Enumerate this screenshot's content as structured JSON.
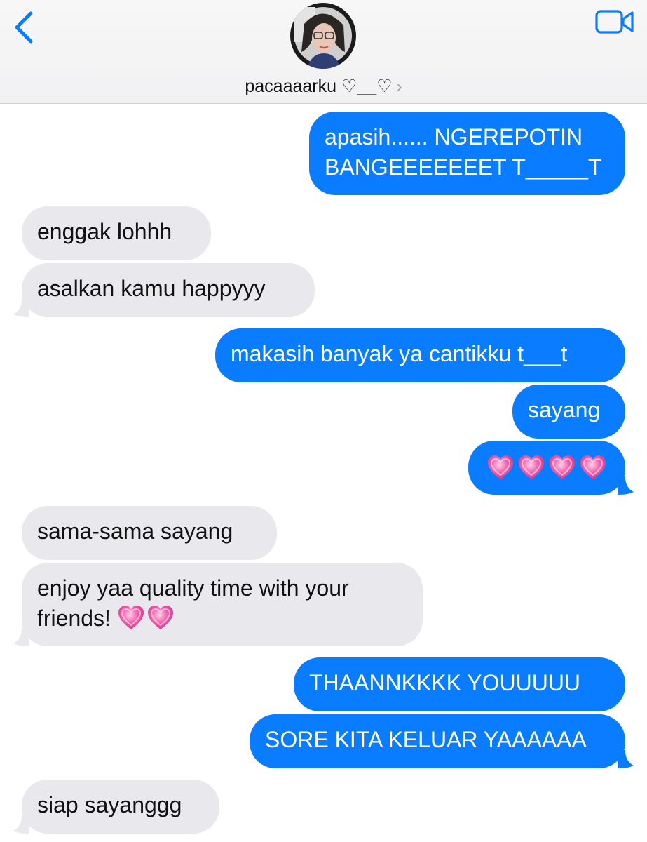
{
  "header": {
    "contact_name": "pacaaaarku ♡__♡",
    "chevron": "›",
    "back_icon": "chevron-left-icon",
    "video_icon": "video-camera-icon",
    "accent": "#0a7cff"
  },
  "messages": [
    {
      "dir": "out",
      "lines": [
        "apasih...... NGEREPOTIN",
        "BANGEEEEEEET T_____T"
      ]
    },
    {
      "dir": "in",
      "text": "enggak lohhh"
    },
    {
      "dir": "in",
      "text": "asalkan kamu happyyy"
    },
    {
      "dir": "out",
      "text": "makasih banyak ya cantikku t___t"
    },
    {
      "dir": "out",
      "text": "sayang"
    },
    {
      "dir": "out",
      "hearts": 4
    },
    {
      "dir": "in",
      "text": "sama-sama sayang"
    },
    {
      "dir": "in",
      "lines": [
        "enjoy yaa quality time with your",
        "friends!"
      ],
      "hearts": 2
    },
    {
      "dir": "out",
      "text": "THAANNKKKK YOUUUUU"
    },
    {
      "dir": "out",
      "text": "SORE KITA KELUAR YAAAAAA"
    },
    {
      "dir": "in",
      "text": "siap sayanggg"
    }
  ],
  "colors": {
    "outgoing_bubble": "#0a7cff",
    "incoming_bubble": "#e8e8ed",
    "heart": "#f25caa"
  }
}
